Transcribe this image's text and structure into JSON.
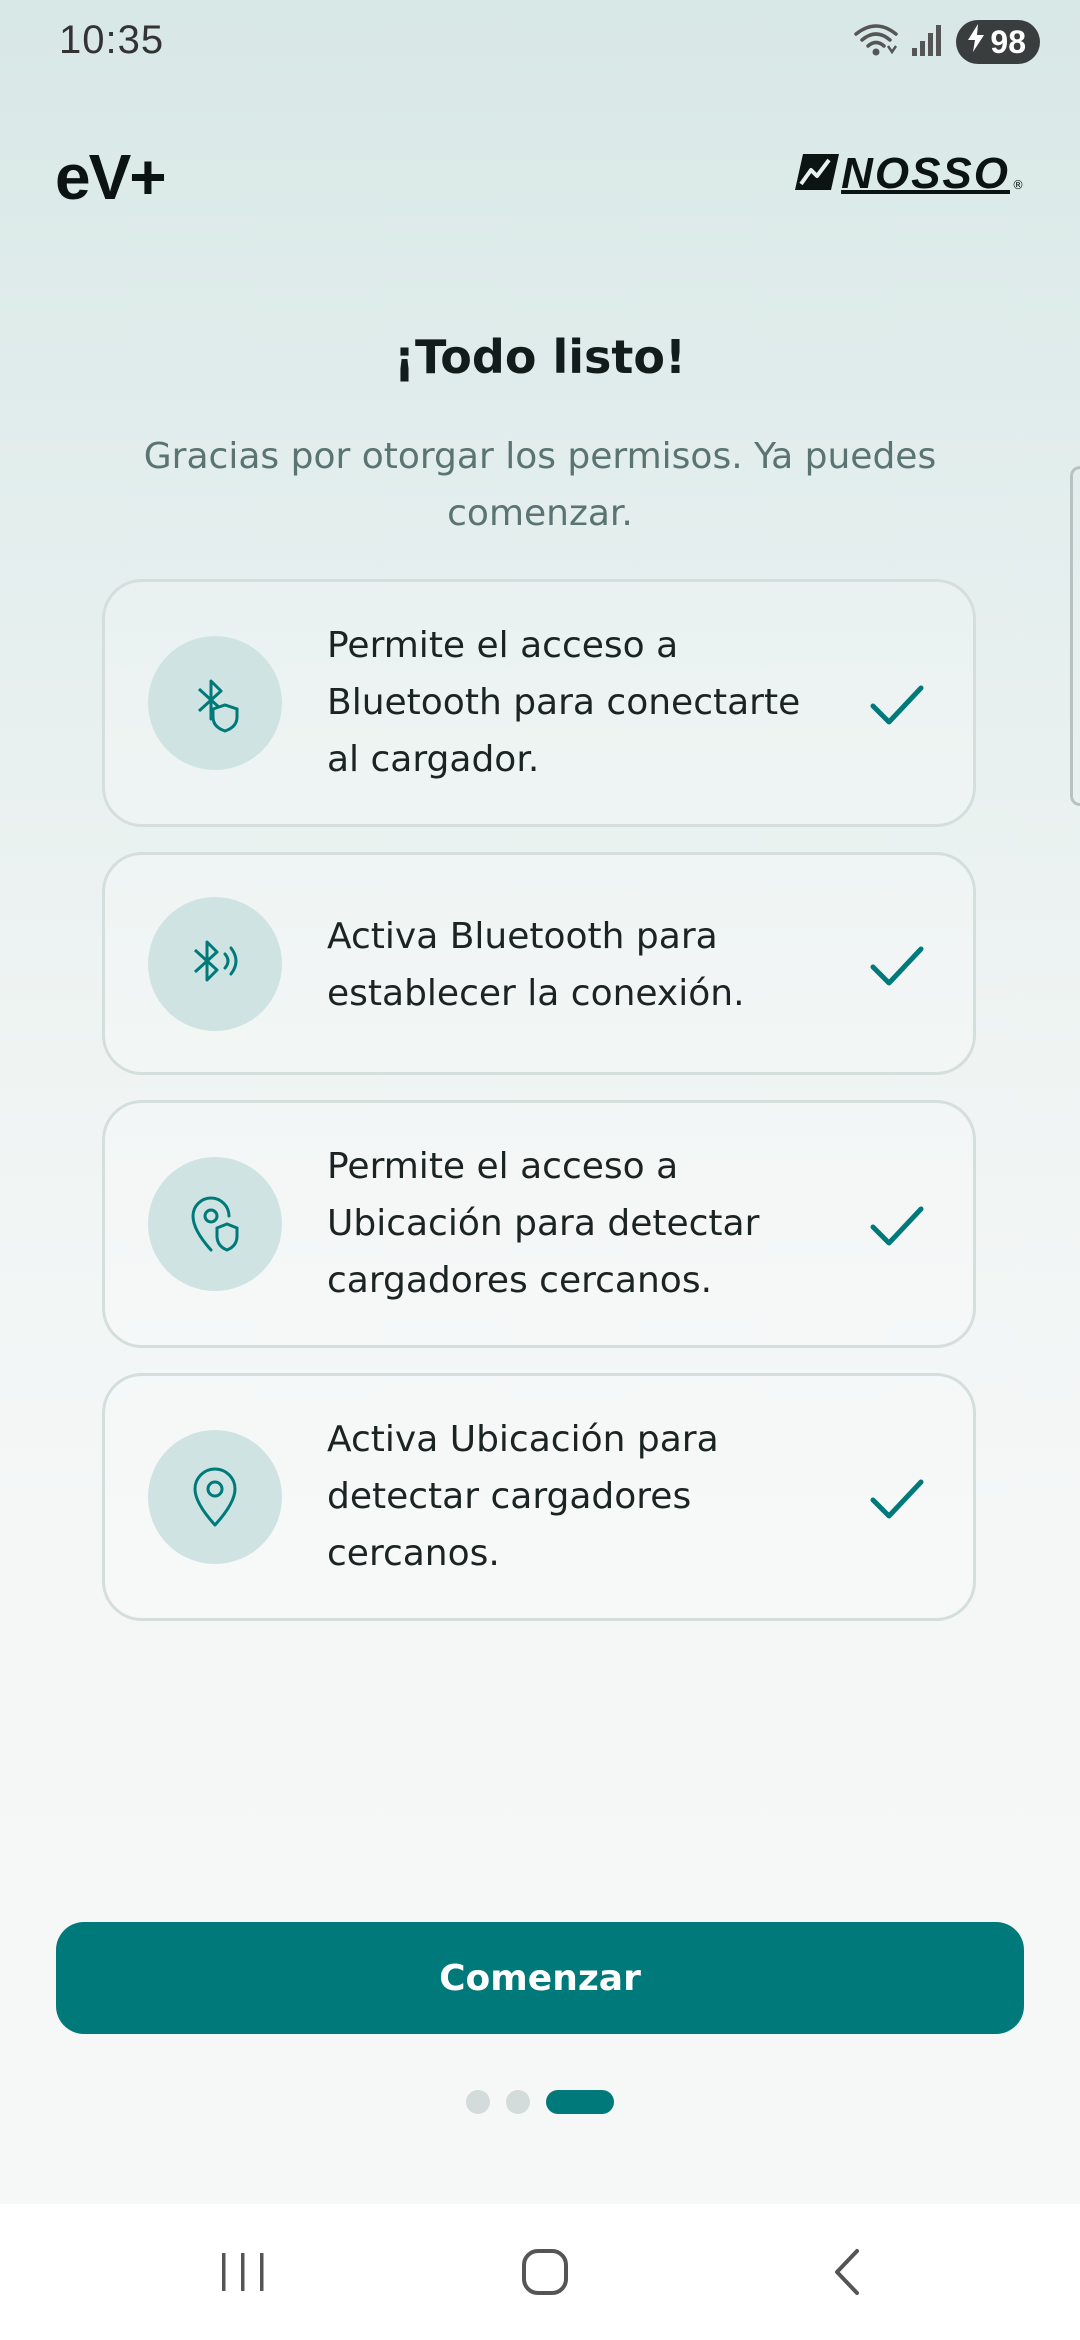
{
  "status_bar": {
    "time": "10:35",
    "battery": "98",
    "icons": [
      "wifi-icon",
      "signal-icon",
      "charging-icon"
    ]
  },
  "header": {
    "app_logo": "eV+",
    "partner_logo": "NOSSO",
    "partner_logo_mark": "®"
  },
  "main": {
    "title": "¡Todo listo!",
    "subtitle": "Gracias por otorgar los permisos. Ya puedes comenzar.",
    "permissions": [
      {
        "icon": "bluetooth-shield-icon",
        "text": "Permite el acceso a Bluetooth para conectarte al cargador.",
        "status": "granted"
      },
      {
        "icon": "bluetooth-signal-icon",
        "text": "Activa Bluetooth para establecer la conexión.",
        "status": "granted"
      },
      {
        "icon": "location-shield-icon",
        "text": "Permite el acceso a Ubicación para detectar cargadores cercanos.",
        "status": "granted"
      },
      {
        "icon": "location-pin-icon",
        "text": "Activa Ubicación para detectar cargadores cercanos.",
        "status": "granted"
      }
    ],
    "start_button": "Comenzar"
  },
  "pager": {
    "total": 3,
    "current": 3
  },
  "nav_bar": {
    "buttons": [
      "recents-icon",
      "home-icon",
      "back-icon"
    ]
  },
  "colors": {
    "accent": "#00797a",
    "icon_bg": "#cfe4e2",
    "text": "#1b2423",
    "subtitle": "#5a7472"
  }
}
